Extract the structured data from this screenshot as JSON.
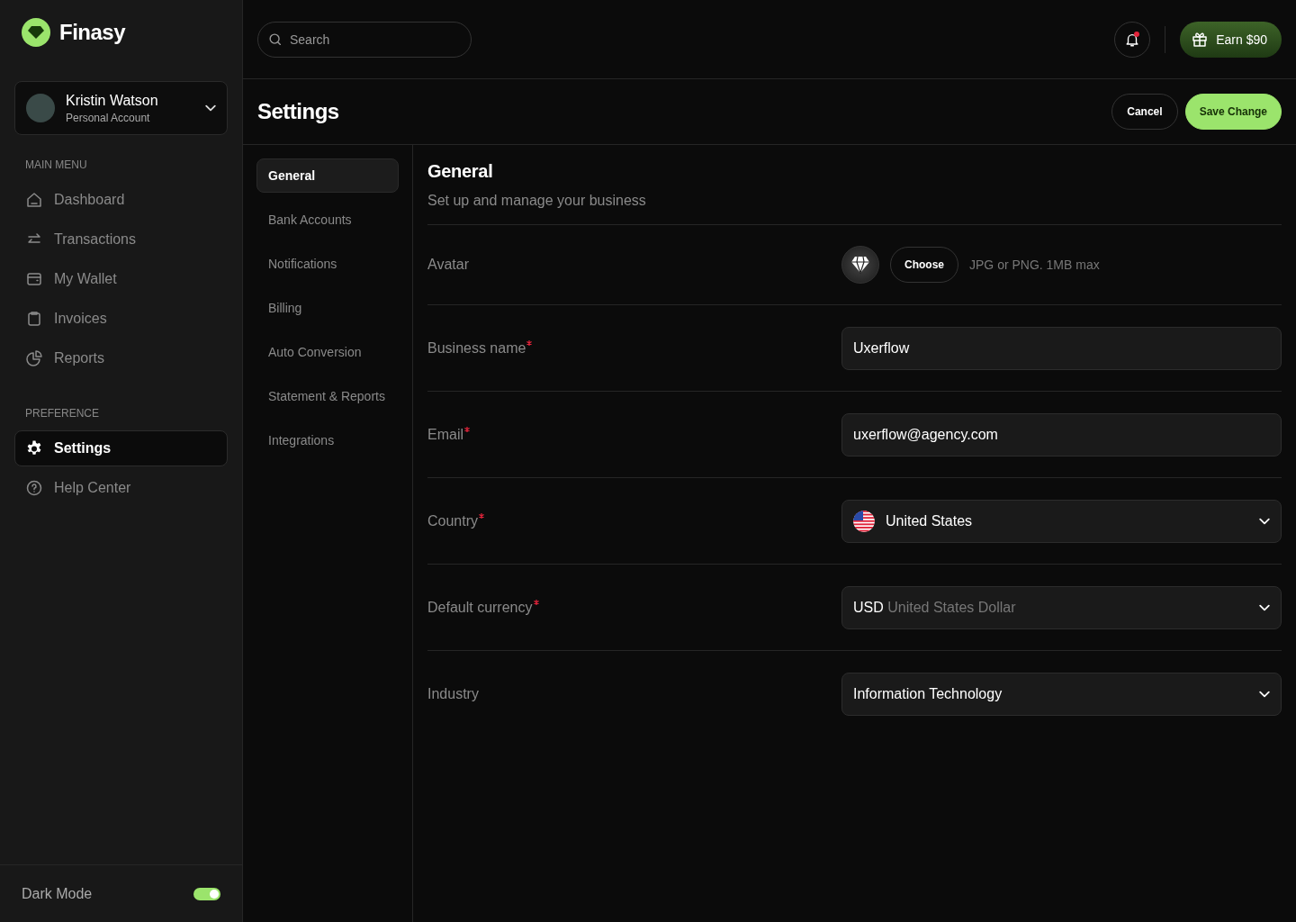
{
  "brand": {
    "name": "Finasy"
  },
  "account": {
    "name": "Kristin Watson",
    "type": "Personal Account"
  },
  "main_menu": {
    "heading": "MAIN MENU",
    "items": [
      {
        "label": "Dashboard",
        "selected": false
      },
      {
        "label": "Transactions",
        "selected": false
      },
      {
        "label": "My Wallet",
        "selected": false
      },
      {
        "label": "Invoices",
        "selected": false
      },
      {
        "label": "Reports",
        "selected": false
      }
    ]
  },
  "preference": {
    "heading": "PREFERENCE",
    "items": [
      {
        "label": "Settings",
        "selected": true
      },
      {
        "label": "Help Center",
        "selected": false
      }
    ]
  },
  "dark_mode": {
    "label": "Dark Mode",
    "on": true
  },
  "topbar": {
    "search": {
      "placeholder": "Search"
    },
    "notification_unread": true,
    "earn_button": "Earn $90"
  },
  "page": {
    "title": "Settings",
    "buttons": {
      "cancel": "Cancel",
      "save": "Save Change"
    }
  },
  "settings_tabs": [
    {
      "label": "General",
      "selected": true
    },
    {
      "label": "Bank Accounts",
      "selected": false
    },
    {
      "label": "Notifications",
      "selected": false
    },
    {
      "label": "Billing",
      "selected": false
    },
    {
      "label": "Auto Conversion",
      "selected": false
    },
    {
      "label": "Statement & Reports",
      "selected": false
    },
    {
      "label": "Integrations",
      "selected": false
    }
  ],
  "section": {
    "title": "General",
    "subtitle": "Set up and manage your business"
  },
  "fields": [
    {
      "kind": "avatar",
      "label": "Avatar",
      "required": false,
      "button": "Choose",
      "hint": "JPG or PNG. 1MB max"
    },
    {
      "kind": "text",
      "label": "Business name",
      "required": true,
      "value": "Uxerflow"
    },
    {
      "kind": "text",
      "label": "Email",
      "required": true,
      "value": "uxerflow@agency.com"
    },
    {
      "kind": "country",
      "label": "Country",
      "required": true,
      "value": "United States"
    },
    {
      "kind": "currency",
      "label": "Default currency",
      "required": true,
      "code": "USD",
      "value": "United States Dollar"
    },
    {
      "kind": "select",
      "label": "Industry",
      "required": false,
      "value": "Information Technology"
    }
  ]
}
